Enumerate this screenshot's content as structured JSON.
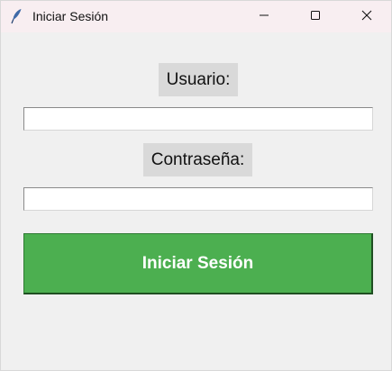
{
  "window": {
    "title": "Iniciar Sesión",
    "app_icon": "feather-icon",
    "controls": {
      "minimize_icon": "minimize-icon",
      "maximize_icon": "maximize-icon",
      "close_icon": "close-icon"
    },
    "titlebar_color": "#f8eef1"
  },
  "form": {
    "username_label": "Usuario:",
    "username_value": "",
    "password_label": "Contraseña:",
    "password_value": "",
    "login_button_label": "Iniciar Sesión",
    "login_button_color": "#4caf50",
    "label_background": "#d9d9d9",
    "background": "#f0f0f0"
  }
}
